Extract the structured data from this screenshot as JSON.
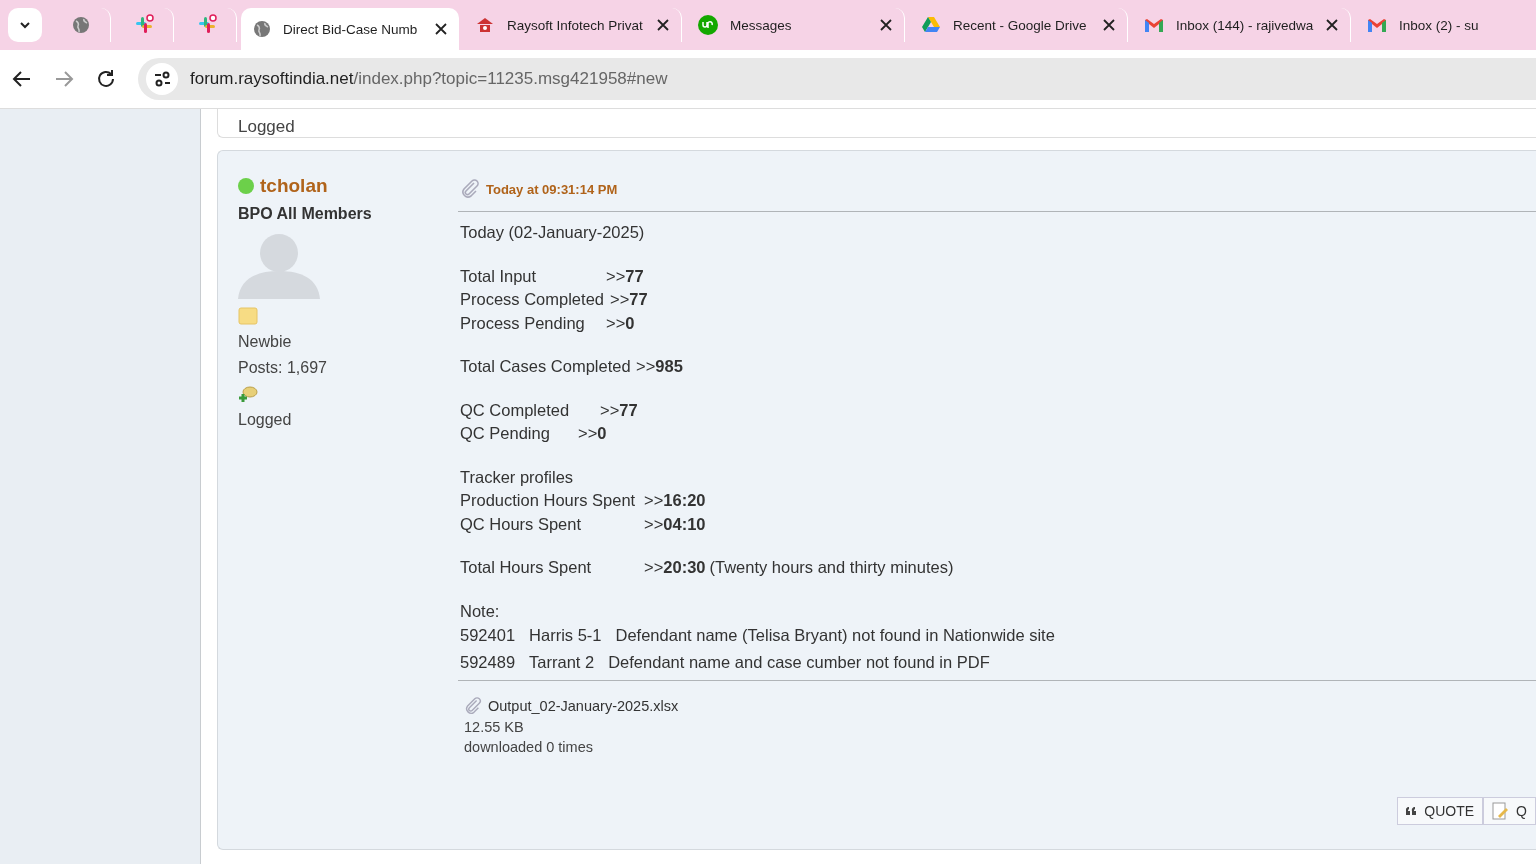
{
  "tabs": [
    {
      "kind": "pinned",
      "selected": false
    },
    {
      "kind": "pinned",
      "selected": false
    },
    {
      "kind": "pinned",
      "selected": false
    },
    {
      "kind": "normal",
      "title": "Direct Bid-Case Numb",
      "selected": true
    },
    {
      "kind": "normal",
      "title": "Raysoft Infotech Privat",
      "selected": false
    },
    {
      "kind": "normal",
      "title": "Messages",
      "selected": false
    },
    {
      "kind": "normal",
      "title": "Recent - Google Drive",
      "selected": false
    },
    {
      "kind": "normal",
      "title": "Inbox (144) - rajivedwa",
      "selected": false
    },
    {
      "kind": "normal",
      "title": "Inbox (2) - su",
      "selected": false
    }
  ],
  "address": {
    "domain": "forum.raysoftindia.net",
    "path": "/index.php?topic=11235.msg421958#new"
  },
  "previous_post": {
    "logged": "Logged"
  },
  "post": {
    "author": "tcholan",
    "online": true,
    "group": "BPO All Members",
    "rank": "Newbie",
    "posts": "Posts: 1,697",
    "logged": "Logged",
    "time": "Today at 09:31:14 PM",
    "heading": "Today (02-January-2025)",
    "groups": [
      [
        {
          "label": "Total Input",
          "arrow": ">>",
          "value": "77"
        },
        {
          "label": "Process Completed",
          "arrow": ">>",
          "value": "77"
        },
        {
          "label": "Process Pending",
          "arrow": ">>",
          "value": "0"
        }
      ],
      [
        {
          "label": "Total Cases Completed",
          "arrow": ">>",
          "value": "985"
        }
      ],
      [
        {
          "label": "QC Completed",
          "arrow": ">>",
          "value": "77"
        },
        {
          "label": "QC Pending",
          "arrow": ">>",
          "value": "0"
        }
      ],
      [
        {
          "label": "Tracker profiles"
        },
        {
          "label": "Production Hours Spent",
          "arrow": ">>",
          "value": "16:20"
        },
        {
          "label": "QC Hours Spent",
          "arrow": ">>",
          "value": "04:10"
        }
      ],
      [
        {
          "label": "Total Hours Spent",
          "arrow": ">>",
          "value": "20:30",
          "rest": "(Twenty hours and thirty minutes)"
        }
      ]
    ],
    "note_label": "Note:",
    "notes": [
      {
        "id": "592401",
        "county": "Harris 5-1",
        "text": "Defendant name (Telisa Bryant) not found in Nationwide site"
      },
      {
        "id": "592489",
        "county": "Tarrant 2",
        "text": "Defendant name and case cumber not found in PDF"
      }
    ],
    "attachment": {
      "name": "Output_02-January-2025.xlsx",
      "size": "12.55 KB",
      "downloads": "downloaded 0 times"
    },
    "buttons": [
      {
        "kind": "quote",
        "label": "QUOTE"
      },
      {
        "kind": "edit",
        "label": "Q"
      }
    ]
  }
}
